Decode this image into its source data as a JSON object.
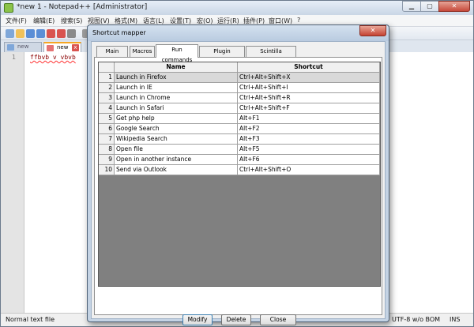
{
  "window": {
    "title": "*new  1 - Notepad++ [Administrator]",
    "minimize_glyph": "▁",
    "maximize_glyph": "▢",
    "close_glyph": "✕"
  },
  "menu": [
    "文件(F)",
    "编辑(E)",
    "搜索(S)",
    "视图(V)",
    "格式(M)",
    "语言(L)",
    "设置(T)",
    "宏(O)",
    "运行(R)",
    "插件(P)",
    "窗口(W)",
    "?"
  ],
  "toolbar_icons": [
    "new-file-icon",
    "open-file-icon",
    "save-icon",
    "save-all-icon",
    "close-icon",
    "close-all-icon",
    "print-icon",
    "cut-icon",
    "copy-icon",
    "paste-icon",
    "undo-icon",
    "redo-icon",
    "find-icon",
    "replace-icon",
    "zoom-in-icon",
    "zoom-out-icon",
    "sync-v-icon",
    "sync-h-icon",
    "wrap-icon",
    "all-chars-icon",
    "indent-guide-icon",
    "udl-icon",
    "doc-map-icon",
    "function-list-icon",
    "folder-workspace-icon",
    "record-macro-icon",
    "stop-record-icon",
    "play-macro-icon",
    "run-macro-icon",
    "save-macro-icon"
  ],
  "doc_tabs": [
    {
      "label": "new",
      "state": "inactive"
    },
    {
      "label": "new",
      "state": "active",
      "close_glyph": "x"
    }
  ],
  "editor": {
    "line_number": "1",
    "text": "ffbvb  v  vbvb"
  },
  "status": {
    "left": "Normal text file",
    "encoding": "UTF-8 w/o BOM",
    "mode": "INS"
  },
  "dialog": {
    "title": "Shortcut mapper",
    "close_glyph": "✕",
    "tabs": [
      "Main menu",
      "Macros",
      "Run commands",
      "Plugin commands",
      "Scintilla commands"
    ],
    "selected_tab": "Run commands",
    "columns": {
      "num": "",
      "name": "Name",
      "shortcut": "Shortcut"
    },
    "rows": [
      {
        "num": "1",
        "name": "Launch in Firefox",
        "shortcut": "Ctrl+Alt+Shift+X"
      },
      {
        "num": "2",
        "name": "Launch in IE",
        "shortcut": "Ctrl+Alt+Shift+I"
      },
      {
        "num": "3",
        "name": "Launch in Chrome",
        "shortcut": "Ctrl+Alt+Shift+R"
      },
      {
        "num": "4",
        "name": "Launch in Safari",
        "shortcut": "Ctrl+Alt+Shift+F"
      },
      {
        "num": "5",
        "name": "Get php help",
        "shortcut": "Alt+F1"
      },
      {
        "num": "6",
        "name": "Google Search",
        "shortcut": "Alt+F2"
      },
      {
        "num": "7",
        "name": "Wikipedia Search",
        "shortcut": "Alt+F3"
      },
      {
        "num": "8",
        "name": "Open file",
        "shortcut": "Alt+F5"
      },
      {
        "num": "9",
        "name": "Open in another instance",
        "shortcut": "Alt+F6"
      },
      {
        "num": "10",
        "name": "Send via Outlook",
        "shortcut": "Ctrl+Alt+Shift+O"
      }
    ],
    "selected_row": 1,
    "buttons": {
      "modify": "Modify",
      "delete": "Delete",
      "close": "Close"
    }
  },
  "colors": {
    "tab_accent": "#f5a623",
    "close_red": "#c54232",
    "grid_empty": "#808080",
    "selected_row": "#d9d9d9"
  }
}
